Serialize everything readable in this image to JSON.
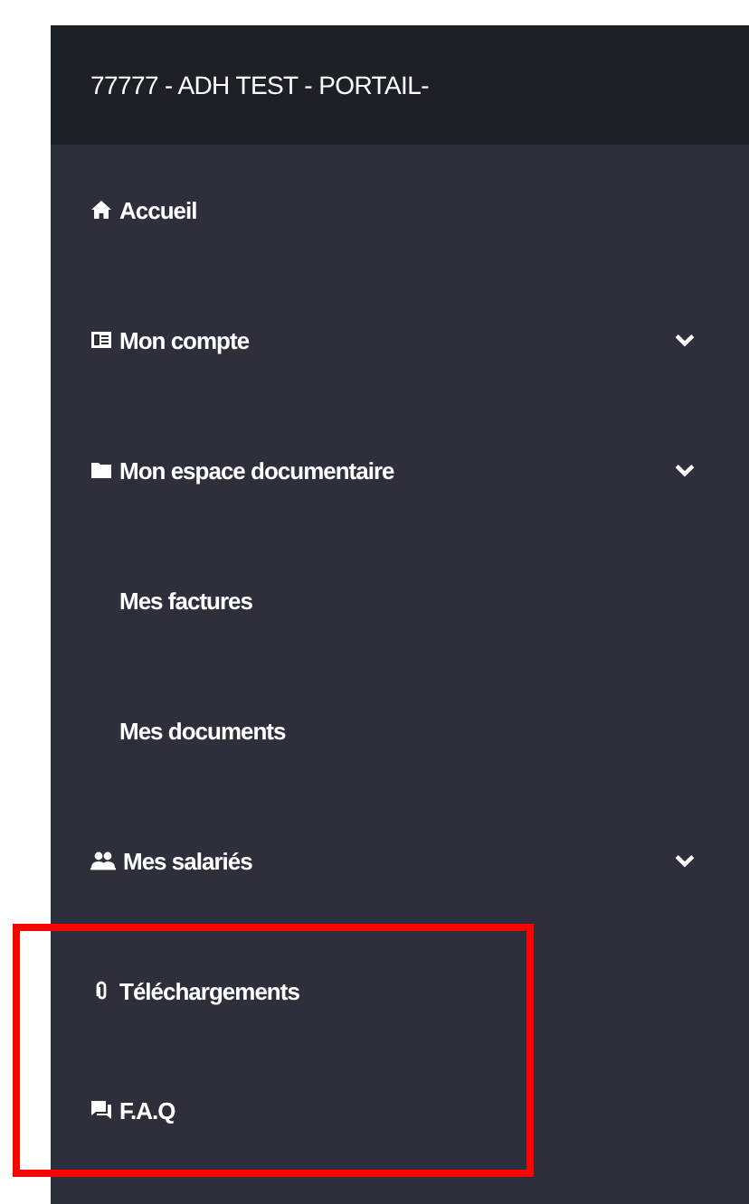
{
  "header": {
    "title": "77777 - ADH TEST - PORTAIL-"
  },
  "menu": [
    {
      "label": "Accueil",
      "kind": "link",
      "expandable": false,
      "highlighted": false
    },
    {
      "label": "Mon compte",
      "kind": "link",
      "expandable": true,
      "highlighted": false
    },
    {
      "label": "Mon espace documentaire",
      "kind": "link",
      "expandable": true,
      "highlighted": false
    },
    {
      "label": "Mes factures",
      "kind": "sublink",
      "expandable": false,
      "highlighted": false
    },
    {
      "label": "Mes documents",
      "kind": "sublink",
      "expandable": false,
      "highlighted": false
    },
    {
      "label": "Mes salariés",
      "kind": "link",
      "expandable": true,
      "highlighted": false
    },
    {
      "label": "Téléchargements",
      "kind": "link",
      "expandable": false,
      "highlighted": true
    },
    {
      "label": "F.A.Q",
      "kind": "link",
      "expandable": false,
      "highlighted": true
    }
  ]
}
